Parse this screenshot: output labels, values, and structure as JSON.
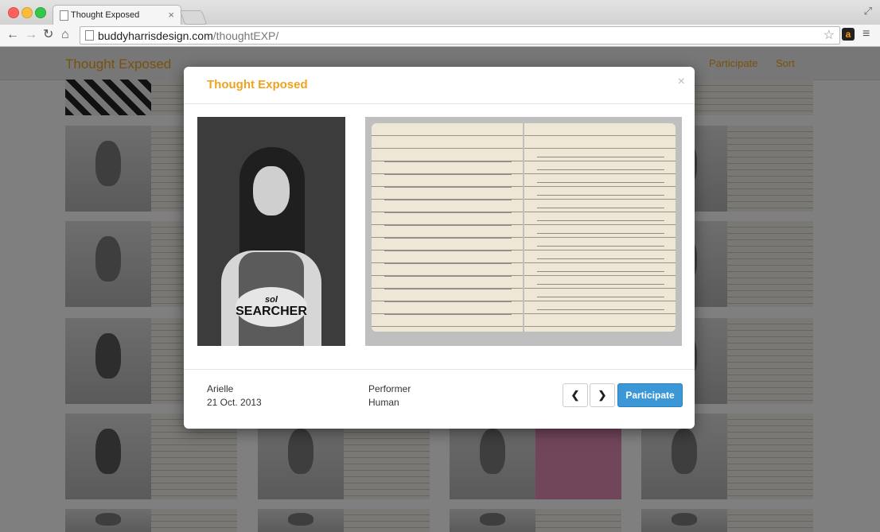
{
  "browser": {
    "tab_title": "Thought Exposed",
    "tab_close": "×",
    "url_host": "buddyharrisdesign.com",
    "url_path": "/thoughtEXP/",
    "back_icon": "arrow-left-icon",
    "forward_icon": "arrow-right-icon",
    "reload_icon": "reload-icon",
    "home_icon": "home-icon",
    "amazon_glyph": "a"
  },
  "site": {
    "brand": "Thought Exposed",
    "nav": [
      "Participate",
      "Sort"
    ],
    "accent": "#f0a31e"
  },
  "modal": {
    "title": "Thought Exposed",
    "close": "×",
    "shirt_line1": "sol",
    "shirt_line2": "SEARCHER",
    "name": "Arielle",
    "date": "21 Oct. 2013",
    "role": "Performer",
    "type": "Human",
    "prev": "❮",
    "next": "❯",
    "participate": "Participate",
    "button_color": "#3c97d6"
  }
}
